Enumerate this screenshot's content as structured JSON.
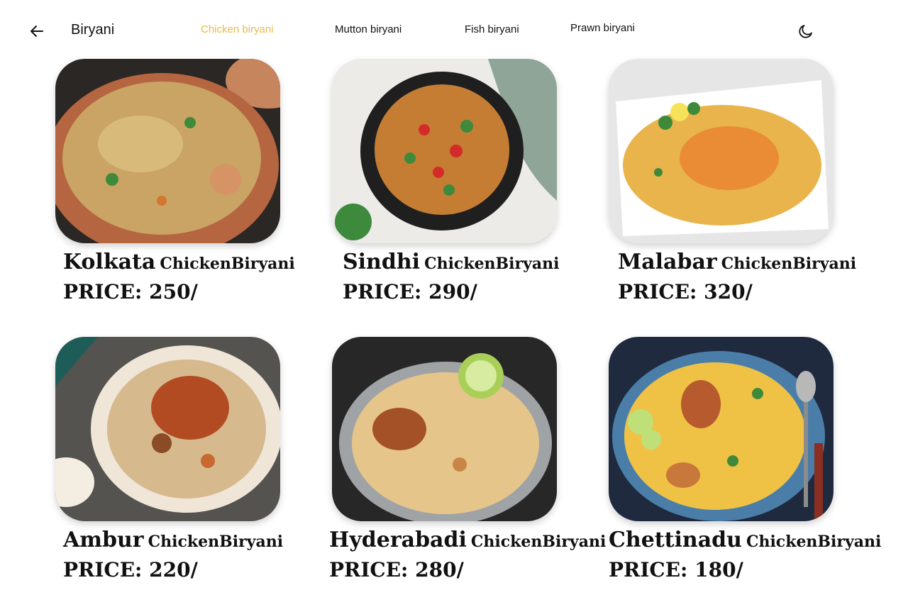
{
  "header": {
    "title": "Biryani",
    "back_icon": "arrow-left-icon",
    "theme_icon": "moon-icon",
    "active_color": "#e9b94a"
  },
  "tabs": [
    {
      "label": "Chicken biryani",
      "active": true
    },
    {
      "label": "Mutton biryani",
      "active": false
    },
    {
      "label": "Fish biryani",
      "active": false
    },
    {
      "label": "Prawn biryani",
      "active": false
    }
  ],
  "items": [
    {
      "city": "Kolkata",
      "kind": "ChickenBiryani",
      "price": "PRICE: 250/"
    },
    {
      "city": "Sindhi",
      "kind": "ChickenBiryani",
      "price": "PRICE: 290/"
    },
    {
      "city": "Malabar",
      "kind": "ChickenBiryani",
      "price": "PRICE: 320/"
    },
    {
      "city": "Ambur",
      "kind": "ChickenBiryani",
      "price": "PRICE: 220/"
    },
    {
      "city": "Hyderabadi",
      "kind": "ChickenBiryani",
      "price": "PRICE: 280/"
    },
    {
      "city": "Chettinadu",
      "kind": "ChickenBiryani",
      "price": "PRICE: 180/"
    }
  ]
}
